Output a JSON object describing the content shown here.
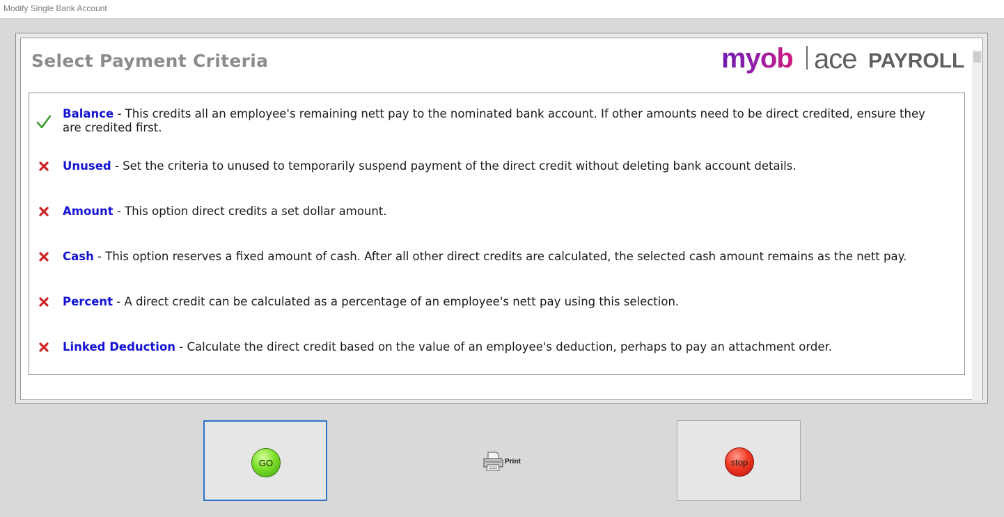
{
  "window": {
    "title": "Modify Single Bank Account"
  },
  "header": {
    "title": "Select Payment Criteria",
    "logo": {
      "brand": "myob",
      "product_a": "ace",
      "product_b": "PAYROLL"
    }
  },
  "criteria": [
    {
      "name": "Balance",
      "desc": " - This credits all an employee's remaining nett pay to the nominated bank account. If other amounts need to be direct credited, ensure they are credited first.",
      "status_icon": "check-icon"
    },
    {
      "name": "Unused",
      "desc": " - Set the criteria to unused to temporarily suspend payment of the direct credit without deleting bank account details.",
      "status_icon": "cross-icon"
    },
    {
      "name": "Amount",
      "desc": " - This option direct credits a set dollar amount.",
      "status_icon": "cross-icon"
    },
    {
      "name": "Cash",
      "desc": " - This option reserves a fixed amount of cash. After all other direct credits are calculated, the selected cash amount remains as the nett pay.",
      "status_icon": "cross-icon"
    },
    {
      "name": "Percent",
      "desc": " - A direct credit can be calculated as a percentage of an employee's nett pay using this selection.",
      "status_icon": "cross-icon"
    },
    {
      "name": "Linked Deduction",
      "desc": " - Calculate the direct credit based on the value of an employee's deduction, perhaps to pay an attachment order.",
      "status_icon": "cross-icon"
    }
  ],
  "buttons": {
    "go": "GO",
    "print": "Print",
    "stop": "stop"
  },
  "colors": {
    "criteria_name": "#1414d2",
    "check": "#3a9a2a",
    "cross": "#cc2222",
    "go_border": "#2a73c9",
    "go": "#6fd12a",
    "stop": "#e8281a"
  }
}
